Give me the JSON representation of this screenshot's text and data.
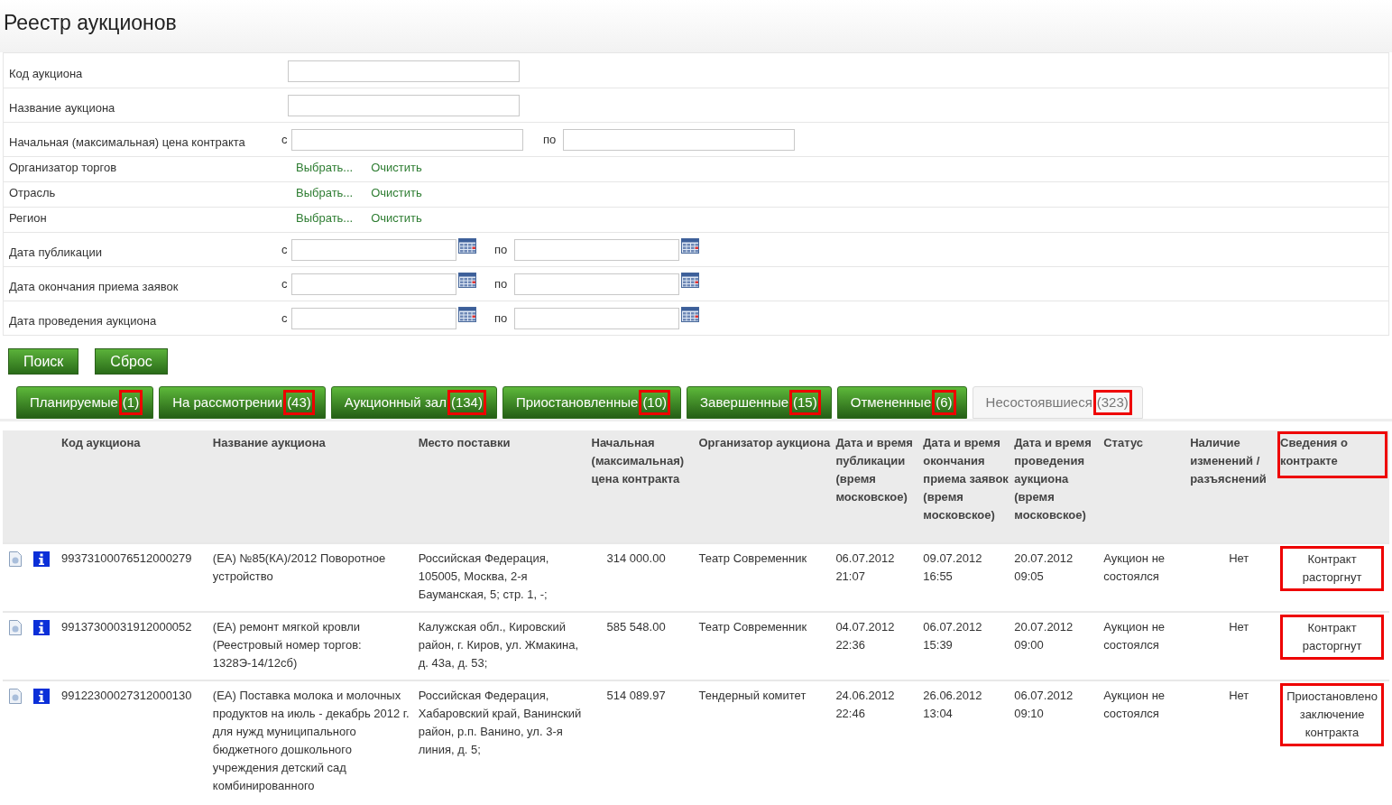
{
  "title": "Реестр аукционов",
  "filters": [
    {
      "kind": "text",
      "label": "Код аукциона"
    },
    {
      "kind": "text",
      "label": "Название аукциона"
    },
    {
      "kind": "range",
      "label": "Начальная (максимальная) цена контракта",
      "from_label": "с",
      "to_label": "по"
    },
    {
      "kind": "picker",
      "label": "Организатор торгов",
      "select": "Выбрать...",
      "clear": "Очистить"
    },
    {
      "kind": "picker",
      "label": "Отрасль",
      "select": "Выбрать...",
      "clear": "Очистить"
    },
    {
      "kind": "picker",
      "label": "Регион",
      "select": "Выбрать...",
      "clear": "Очистить"
    },
    {
      "kind": "date_range",
      "label": "Дата публикации",
      "from_label": "с",
      "to_label": "по"
    },
    {
      "kind": "date_range",
      "label": "Дата окончания приема заявок",
      "from_label": "с",
      "to_label": "по"
    },
    {
      "kind": "date_range",
      "label": "Дата проведения аукциона",
      "from_label": "с",
      "to_label": "по"
    }
  ],
  "buttons": [
    "Поиск",
    "Сброс"
  ],
  "tabs": [
    {
      "label": "Планируемые",
      "count": "(1)",
      "selected": false,
      "highlighted": true
    },
    {
      "label": "На рассмотрении",
      "count": "(43)",
      "selected": false,
      "highlighted": true
    },
    {
      "label": "Аукционный зал",
      "count": "(134)",
      "selected": false,
      "highlighted": true
    },
    {
      "label": "Приостановленные",
      "count": "(10)",
      "selected": false,
      "highlighted": true
    },
    {
      "label": "Завершенные",
      "count": "(15)",
      "selected": false,
      "highlighted": true
    },
    {
      "label": "Отмененные",
      "count": "(6)",
      "selected": false,
      "highlighted": true
    },
    {
      "label": "Несостоявшиеся",
      "count": "(323)",
      "selected": true,
      "highlighted": true
    }
  ],
  "table": {
    "columns": [
      {
        "label": "Код аукциона",
        "highlighted": false
      },
      {
        "label": "Название аукциона",
        "highlighted": false
      },
      {
        "label": "Место поставки",
        "highlighted": false
      },
      {
        "label": "Начальная (максимальная) цена контракта",
        "highlighted": false
      },
      {
        "label": "Организатор аукциона",
        "highlighted": false
      },
      {
        "label": "Дата и время публикации (время московское)",
        "highlighted": false
      },
      {
        "label": "Дата и время окончания приема заявок (время московское)",
        "highlighted": false
      },
      {
        "label": "Дата и время проведения аукциона (время московское)",
        "highlighted": false
      },
      {
        "label": "Статус",
        "highlighted": false
      },
      {
        "label": "Наличие изменений / разъяснений",
        "highlighted": false
      },
      {
        "label": "Сведения о контракте",
        "highlighted": true
      }
    ],
    "rows": [
      {
        "code": "99373100076512000279",
        "name": "(ЕА) №85(КА)/2012 Поворотное устройство",
        "place": "Российская Федерация, 105005, Москва, 2-я Бауманская, 5; стр. 1, -;",
        "price": "314 000.00",
        "organizer": "Театр Современник",
        "published": "06.07.2012 21:07",
        "deadline": "09.07.2012 16:55",
        "held": "20.07.2012 09:05",
        "status": "Аукцион не состоялся",
        "changes": "Нет",
        "contract": "Контракт расторгнут",
        "contract_highlighted": true
      },
      {
        "code": "99137300031912000052",
        "name": "(ЕА) ремонт мягкой кровли (Реестровый номер торгов: 1328Э-14/12сб)",
        "place": "Калужская обл., Кировский район, г. Киров, ул. Жмакина, д. 43а, д. 53;",
        "price": "585 548.00",
        "organizer": "Театр Современник",
        "published": "04.07.2012 22:36",
        "deadline": "06.07.2012 15:39",
        "held": "20.07.2012 09:00",
        "status": "Аукцион не состоялся",
        "changes": "Нет",
        "contract": "Контракт расторгнут",
        "contract_highlighted": true
      },
      {
        "code": "99122300027312000130",
        "name": "(ЕА) Поставка молока и молочных продуктов на июль - декабрь 2012 г. для нужд муниципального бюджетного дошкольного учреждения детский сад комбинированного",
        "place": "Российская Федерация, Хабаровский край, Ванинский район, р.п. Ванино, ул. 3-я линия, д. 5;",
        "price": "514 089.97",
        "organizer": "Тендерный комитет",
        "published": "24.06.2012 22:46",
        "deadline": "26.06.2012 13:04",
        "held": "06.07.2012 09:10",
        "status": "Аукцион не состоялся",
        "changes": "Нет",
        "contract": "Приостановлено заключение контракта",
        "contract_highlighted": true
      }
    ]
  }
}
